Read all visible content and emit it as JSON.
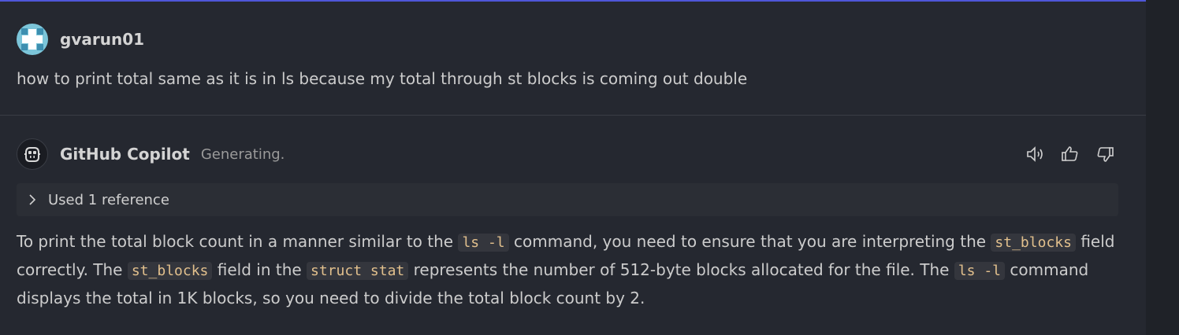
{
  "user": {
    "name": "gvarun01",
    "message": "how to print total same as it is in ls because my total through st blocks is coming out double"
  },
  "assistant": {
    "name": "GitHub Copilot",
    "status": "Generating.",
    "reference_label": "Used 1 reference",
    "icons": [
      "speaker-icon",
      "thumbs-up-icon",
      "thumbs-down-icon"
    ],
    "response": {
      "line1": {
        "t1": "To print the total block count in a manner similar to the ",
        "c1": "ls -l",
        "t2": " command, you need to ensure that you are interpreting the ",
        "c2": "st_blocks",
        "t3": " field"
      },
      "line2": {
        "t1": "correctly. The ",
        "c1": "st_blocks",
        "t2": " field in the ",
        "c2": "struct stat",
        "t3": " represents the number of 512-byte blocks allocated for the file. The ",
        "c3": "ls -l",
        "t4": " command"
      },
      "line3": "displays the total in 1K blocks, so you need to divide the total block count by 2."
    }
  },
  "colors": {
    "background": "#252830",
    "accent": "#4f56d9",
    "code_text": "#e2c08d"
  }
}
